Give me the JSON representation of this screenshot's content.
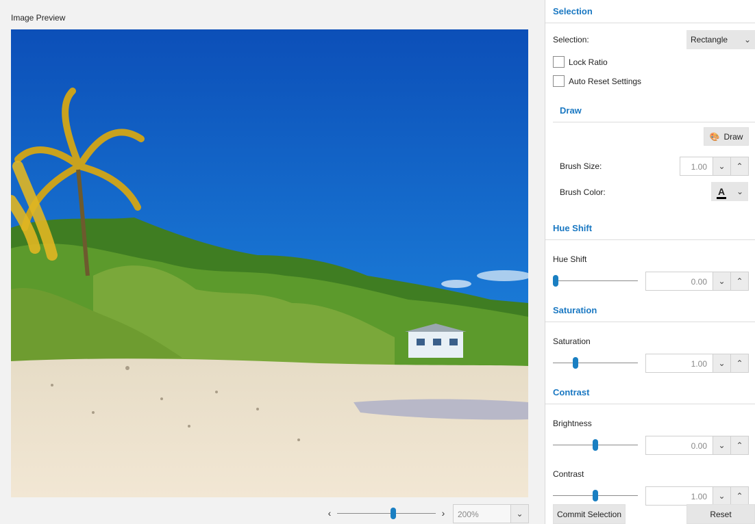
{
  "preview": {
    "title": "Image Preview"
  },
  "zoom": {
    "prev": "‹",
    "next": "›",
    "value": "200%",
    "level_fraction": 0.57
  },
  "selection": {
    "header": "Selection",
    "label": "Selection:",
    "mode": "Rectangle",
    "lock_ratio": "Lock Ratio",
    "auto_reset": "Auto Reset Settings"
  },
  "draw": {
    "header": "Draw",
    "button": "Draw",
    "brush_size_label": "Brush Size:",
    "brush_size": "1.00",
    "brush_color_label": "Brush Color:",
    "brush_color_glyph": "A"
  },
  "hue": {
    "header": "Hue Shift",
    "label": "Hue Shift",
    "value": "0.00",
    "level_fraction": 0.0
  },
  "saturation": {
    "header": "Saturation",
    "label": "Saturation",
    "value": "1.00",
    "level_fraction": 0.25
  },
  "contrast": {
    "header": "Contrast",
    "brightness_label": "Brightness",
    "brightness": "0.00",
    "brightness_fraction": 0.5,
    "contrast_label": "Contrast",
    "contrast": "1.00",
    "contrast_fraction": 0.5
  },
  "footer": {
    "commit": "Commit Selection",
    "reset": "Reset"
  },
  "icons": {
    "chevron_down": "⌄",
    "spin_down": "⌄",
    "spin_up": "⌃",
    "palette": "palette-icon"
  }
}
